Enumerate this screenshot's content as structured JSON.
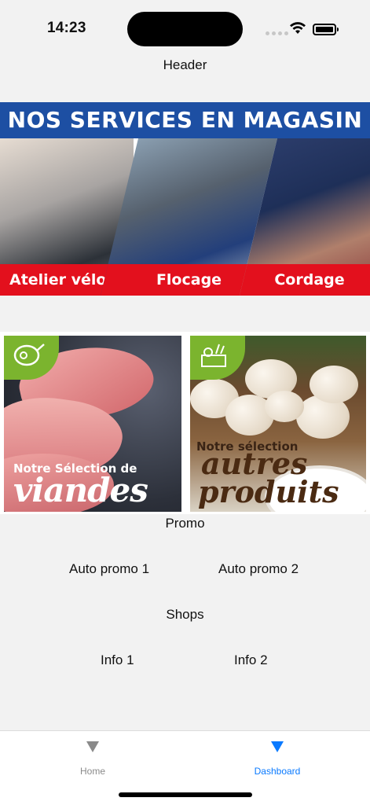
{
  "status_bar": {
    "time": "14:23"
  },
  "header": {
    "title": "Header"
  },
  "services_banner": {
    "title": "NOS SERVICES EN MAGASIN",
    "items": [
      {
        "label": "Atelier vélo"
      },
      {
        "label": "Flocage"
      },
      {
        "label": "Cordage"
      }
    ]
  },
  "promo_cards": [
    {
      "caption": "Notre Sélection de",
      "title": "viandes",
      "icon": "meat-icon"
    },
    {
      "caption": "Notre sélection",
      "title_line1": "autres",
      "title_line2": "produits",
      "icon": "grocery-icon"
    }
  ],
  "sections": {
    "promo": "Promo",
    "auto_promo": [
      "Auto promo 1",
      "Auto promo 2"
    ],
    "shops": "Shops",
    "info": [
      "Info 1",
      "Info 2"
    ]
  },
  "tab_bar": {
    "tabs": [
      {
        "label": "Home",
        "icon": "triangle-down-icon",
        "active": false
      },
      {
        "label": "Dashboard",
        "icon": "triangle-down-icon",
        "active": true
      }
    ],
    "active_color": "#0a7aff",
    "inactive_color": "#8a8a8a"
  },
  "colors": {
    "banner_blue": "#1d4fa3",
    "banner_red": "#e3101d",
    "badge_green": "#7bb42e"
  }
}
